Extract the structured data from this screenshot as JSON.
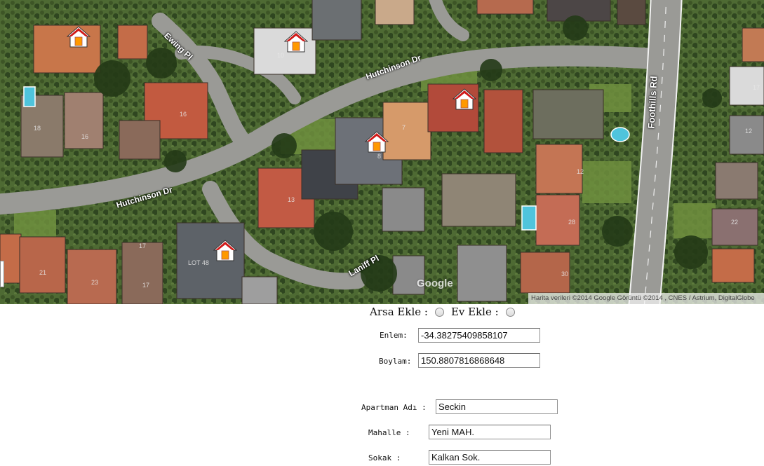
{
  "map": {
    "roads": [
      {
        "id": "ewing",
        "label": "Ewing Pl"
      },
      {
        "id": "hutchinson_upper",
        "label": "Hutchinson Dr"
      },
      {
        "id": "hutchinson_lower",
        "label": "Hutchinson Dr"
      },
      {
        "id": "foothills",
        "label": "Foothills Rd"
      },
      {
        "id": "laniff",
        "label": "Laniff Pl"
      }
    ],
    "house_numbers": [
      "10",
      "18",
      "16",
      "16",
      "8",
      "7",
      "13",
      "17",
      "12",
      "22",
      "28",
      "30",
      "17",
      "LOT 48",
      "17",
      "23",
      "21",
      "12"
    ],
    "markers": [
      {
        "name": "house-marker-1",
        "icon": "house-marker-icon"
      },
      {
        "name": "house-marker-2",
        "icon": "house-marker-icon"
      },
      {
        "name": "house-marker-3",
        "icon": "house-marker-icon"
      },
      {
        "name": "house-marker-4",
        "icon": "house-marker-icon"
      },
      {
        "name": "house-marker-5",
        "icon": "house-marker-icon"
      }
    ],
    "logo": "Google",
    "attribution": "Harita verileri ©2014 Google Görüntü ©2014 , CNES / Astrium, DigitalGlobe",
    "colors": {
      "marker_roof": "#d01818",
      "marker_door": "#ff9900",
      "road": "#9a9a96"
    }
  },
  "form": {
    "arsa_label": "Arsa Ekle :",
    "ev_label": "Ev Ekle :",
    "arsa_selected": false,
    "ev_selected": false,
    "enlem_label": "Enlem:",
    "enlem_value": "-34.38275409858107",
    "boylam_label": "Boylam:",
    "boylam_value": "150.8807816868648",
    "apartman_label": "Apartman Adı :",
    "apartman_value": "Seckin",
    "mahalle_label": "Mahalle :",
    "mahalle_value": "Yeni MAH.",
    "sokak_label": "Sokak :",
    "sokak_value": "Kalkan Sok."
  }
}
